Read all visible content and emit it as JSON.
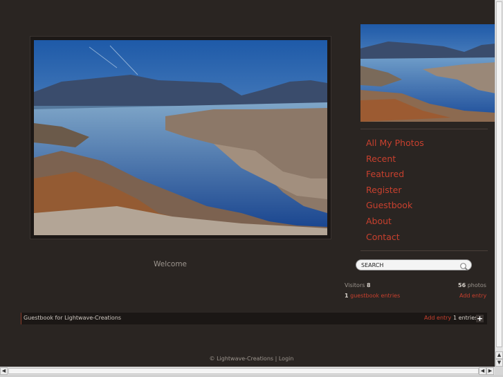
{
  "nav": {
    "items": [
      {
        "label": "All My Photos"
      },
      {
        "label": "Recent"
      },
      {
        "label": "Featured"
      },
      {
        "label": "Register"
      },
      {
        "label": "Guestbook"
      },
      {
        "label": "About"
      },
      {
        "label": "Contact"
      }
    ]
  },
  "welcome": "Welcome",
  "search": {
    "placeholder": "SEARCH"
  },
  "stats": {
    "visitors_label": "Visitors",
    "visitors_count": "8",
    "photos_count": "56",
    "photos_label": "photos",
    "guestbook_count": "1",
    "guestbook_entries_label": "guestbook entries",
    "add_entry": "Add entry"
  },
  "guestbook": {
    "title": "Guestbook for Lightwave-Creations",
    "add_entry": "Add entry",
    "count": "1",
    "entries_label": "entries"
  },
  "footer": {
    "copyright": "© Lightwave-Creations",
    "separator": "|",
    "login": "Login"
  },
  "icons": {
    "search": "magnifier-icon",
    "add": "plus-icon"
  },
  "colors": {
    "background": "#2a2522",
    "accent": "#c8402e",
    "text": "#bdb6ae"
  }
}
